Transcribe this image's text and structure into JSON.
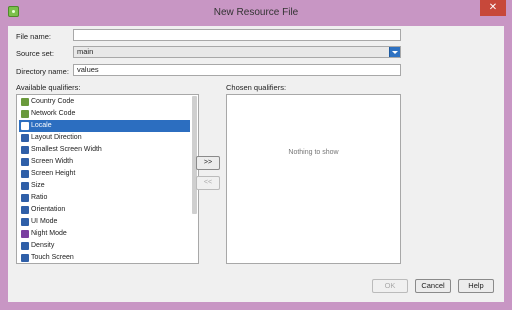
{
  "window": {
    "title": "New Resource File",
    "close_label": "✕"
  },
  "form": {
    "file_name_label": "File name:",
    "file_name_value": "",
    "source_set_label": "Source set:",
    "source_set_value": "main",
    "directory_label": "Directory name:",
    "directory_value": "values"
  },
  "available": {
    "label": "Available qualifiers:",
    "items": [
      {
        "label": "Country Code",
        "icon": "globe-icon",
        "color": "#6a9a3c"
      },
      {
        "label": "Network Code",
        "icon": "network-icon",
        "color": "#6a9a3c"
      },
      {
        "label": "Locale",
        "icon": "locale-icon",
        "color": "#ffffff"
      },
      {
        "label": "Layout Direction",
        "icon": "layout-direction-icon",
        "color": "#2f5fa8"
      },
      {
        "label": "Smallest Screen Width",
        "icon": "smallest-width-icon",
        "color": "#2f5fa8"
      },
      {
        "label": "Screen Width",
        "icon": "screen-width-icon",
        "color": "#2f5fa8"
      },
      {
        "label": "Screen Height",
        "icon": "screen-height-icon",
        "color": "#2f5fa8"
      },
      {
        "label": "Size",
        "icon": "size-icon",
        "color": "#2f5fa8"
      },
      {
        "label": "Ratio",
        "icon": "ratio-icon",
        "color": "#2f5fa8"
      },
      {
        "label": "Orientation",
        "icon": "orientation-icon",
        "color": "#2f5fa8"
      },
      {
        "label": "UI Mode",
        "icon": "ui-mode-icon",
        "color": "#2f5fa8"
      },
      {
        "label": "Night Mode",
        "icon": "night-mode-icon",
        "color": "#7a3fa0"
      },
      {
        "label": "Density",
        "icon": "density-icon",
        "color": "#2f5fa8"
      },
      {
        "label": "Touch Screen",
        "icon": "touch-screen-icon",
        "color": "#2f5fa8"
      }
    ],
    "selected_index": 2
  },
  "chosen": {
    "label": "Chosen qualifiers:",
    "empty_text": "Nothing to show"
  },
  "buttons": {
    "add": ">>",
    "remove": "<<",
    "ok": "OK",
    "cancel": "Cancel",
    "help": "Help"
  }
}
